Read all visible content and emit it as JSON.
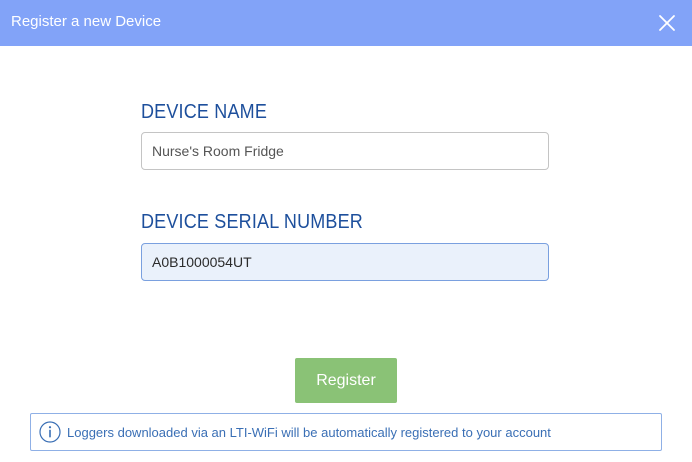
{
  "dialog": {
    "title": "Register a new Device",
    "close_icon": "close-icon"
  },
  "form": {
    "device_name": {
      "label": "DEVICE NAME",
      "value": "Nurse's Room Fridge"
    },
    "serial_number": {
      "label": "DEVICE SERIAL NUMBER",
      "value": "A0B1000054UT"
    },
    "register_label": "Register"
  },
  "info": {
    "icon": "info-icon",
    "text": "Loggers downloaded via an LTI-WiFi will be automatically registered to your account"
  },
  "colors": {
    "title_bar": "#82a3f8",
    "label_text": "#1d4f9c",
    "register_button": "#8ac276",
    "info_border": "#8fb0e6",
    "info_text": "#3a6fb5",
    "serial_field_bg": "#eaf1fb"
  }
}
